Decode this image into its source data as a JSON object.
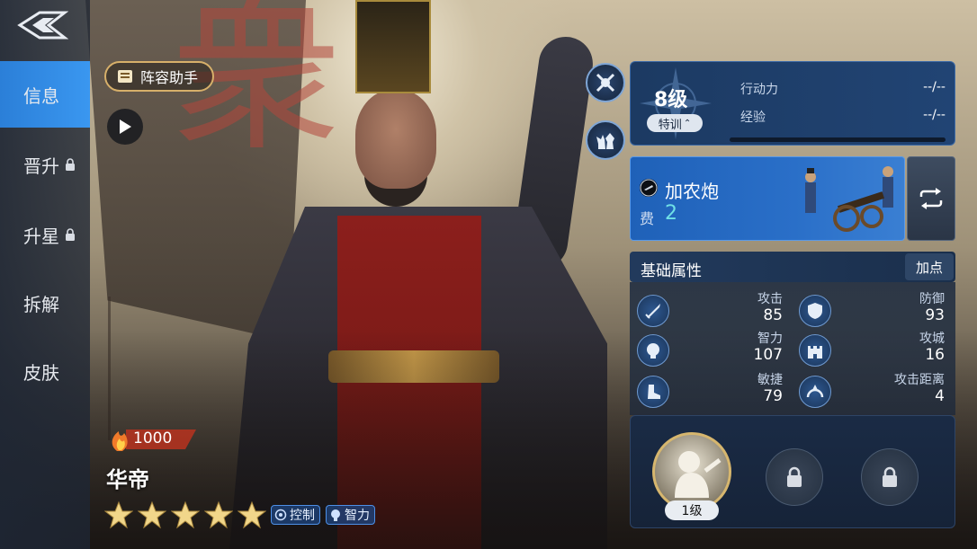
{
  "nav": {
    "items": [
      {
        "label": "信息",
        "active": true,
        "locked": false
      },
      {
        "label": "晋升",
        "active": false,
        "locked": true
      },
      {
        "label": "升星",
        "active": false,
        "locked": true
      },
      {
        "label": "拆解",
        "active": false,
        "locked": false
      },
      {
        "label": "皮肤",
        "active": false,
        "locked": false
      }
    ]
  },
  "helper": {
    "label": "阵容助手"
  },
  "hero": {
    "power": "1000",
    "name": "华帝",
    "stars": 5,
    "tags": [
      {
        "label": "控制",
        "icon": "target-icon"
      },
      {
        "label": "智力",
        "icon": "head-icon"
      }
    ]
  },
  "level": {
    "level_label": "8级",
    "train_label": "特训",
    "rows": [
      {
        "label": "行动力",
        "value": "--/--"
      },
      {
        "label": "经验",
        "value": "--/--"
      }
    ]
  },
  "unit": {
    "name": "加农炮",
    "cost_label": "费",
    "cost": "2"
  },
  "attributes": {
    "title": "基础属性",
    "add_points_label": "加点",
    "items": [
      {
        "name": "攻击",
        "value": "85",
        "icon": "sword-icon"
      },
      {
        "name": "防御",
        "value": "93",
        "icon": "shield-icon"
      },
      {
        "name": "智力",
        "value": "107",
        "icon": "brain-icon"
      },
      {
        "name": "攻城",
        "value": "16",
        "icon": "castle-icon"
      },
      {
        "name": "敏捷",
        "value": "79",
        "icon": "boot-icon"
      },
      {
        "name": "攻击距离",
        "value": "4",
        "icon": "range-icon"
      }
    ]
  },
  "skills": {
    "slot1_level": "1级"
  },
  "colors": {
    "nav_active": "#2b7fd8",
    "panel_blue": "#1f61b8",
    "cost_cyan": "#6fe0e6",
    "gold": "#d6b66e"
  }
}
